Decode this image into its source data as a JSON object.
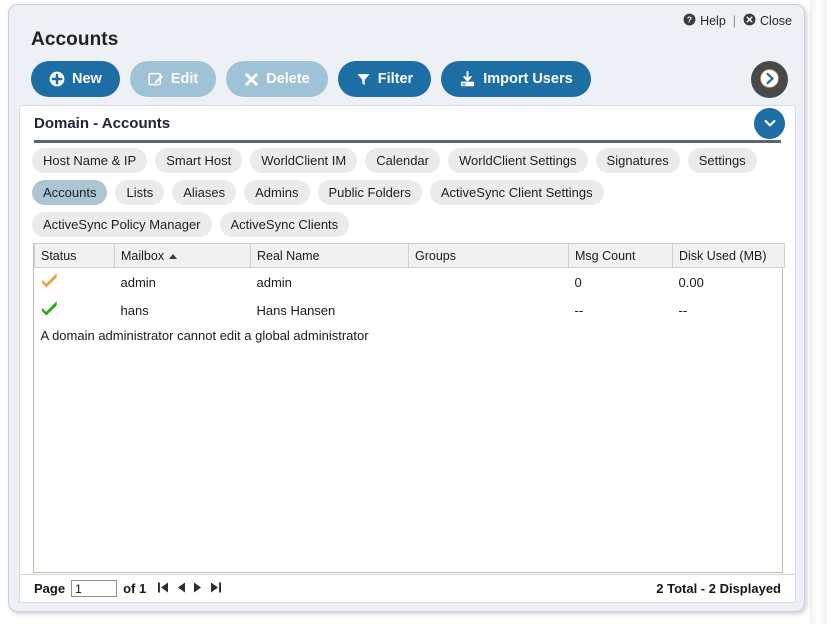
{
  "window": {
    "title": "Accounts",
    "util_links": [
      {
        "label": "Help",
        "icon": "help-circle-icon"
      },
      {
        "label": "Close",
        "icon": "close-circle-icon"
      }
    ],
    "util_separator": "|"
  },
  "toolbar": {
    "buttons": [
      {
        "label": "New",
        "icon": "plus-circle-icon",
        "state": "enabled"
      },
      {
        "label": "Edit",
        "icon": "pencil-square-icon",
        "state": "disabled"
      },
      {
        "label": "Delete",
        "icon": "x-mark-icon",
        "state": "disabled"
      },
      {
        "label": "Filter",
        "icon": "funnel-icon",
        "state": "enabled"
      },
      {
        "label": "Import Users",
        "icon": "download-tray-icon",
        "state": "enabled"
      }
    ],
    "next_button_icon": "chevron-right-circle-icon"
  },
  "section": {
    "title": "Domain - Accounts",
    "collapse_icon": "chevron-down-icon"
  },
  "tabs": {
    "items": [
      {
        "label": "Host Name & IP",
        "active": false
      },
      {
        "label": "Smart Host",
        "active": false
      },
      {
        "label": "WorldClient IM",
        "active": false
      },
      {
        "label": "Calendar",
        "active": false
      },
      {
        "label": "WorldClient Settings",
        "active": false
      },
      {
        "label": "Signatures",
        "active": false
      },
      {
        "label": "Settings",
        "active": false
      },
      {
        "label": "Accounts",
        "active": true
      },
      {
        "label": "Lists",
        "active": false
      },
      {
        "label": "Aliases",
        "active": false
      },
      {
        "label": "Admins",
        "active": false
      },
      {
        "label": "Public Folders",
        "active": false
      },
      {
        "label": "ActiveSync Client Settings",
        "active": false
      },
      {
        "label": "ActiveSync Policy Manager",
        "active": false
      },
      {
        "label": "ActiveSync Clients",
        "active": false
      }
    ]
  },
  "grid": {
    "columns": [
      {
        "label": "Status",
        "sorted": false
      },
      {
        "label": "Mailbox",
        "sorted": true,
        "direction": "asc"
      },
      {
        "label": "Real Name",
        "sorted": false
      },
      {
        "label": "Groups",
        "sorted": false
      },
      {
        "label": "Msg Count",
        "sorted": false
      },
      {
        "label": "Disk Used (MB)",
        "sorted": false
      }
    ],
    "rows": [
      {
        "status_icon": "gold-check-icon",
        "status_color": "#e8a33d",
        "mailbox": "admin",
        "real_name": "admin",
        "groups": "",
        "msg_count": "0",
        "disk_used": "0.00"
      },
      {
        "status_icon": "green-check-icon",
        "status_color": "#2aa81a",
        "mailbox": "hans",
        "real_name": "Hans Hansen",
        "groups": "",
        "msg_count": "--",
        "disk_used": "--"
      }
    ],
    "note": "A domain administrator cannot edit a global administrator"
  },
  "pager": {
    "page_label": "Page",
    "page_value": "1",
    "of_label": "of 1",
    "nav": [
      {
        "name": "first-page-button",
        "icon": "skip-first-icon"
      },
      {
        "name": "previous-page-button",
        "icon": "triangle-left-icon"
      },
      {
        "name": "next-page-button",
        "icon": "triangle-right-icon"
      },
      {
        "name": "last-page-button",
        "icon": "skip-last-icon"
      }
    ],
    "summary": "2 Total - 2 Displayed"
  },
  "colors": {
    "accent_blue": "#1c6ea4",
    "accent_blue_disabled": "#9fc2d6",
    "window_bg": "#edf1f5",
    "tab_active_bg": "#adc5d3",
    "rule_dark": "#5a6673",
    "circle_dark": "#47494b"
  }
}
